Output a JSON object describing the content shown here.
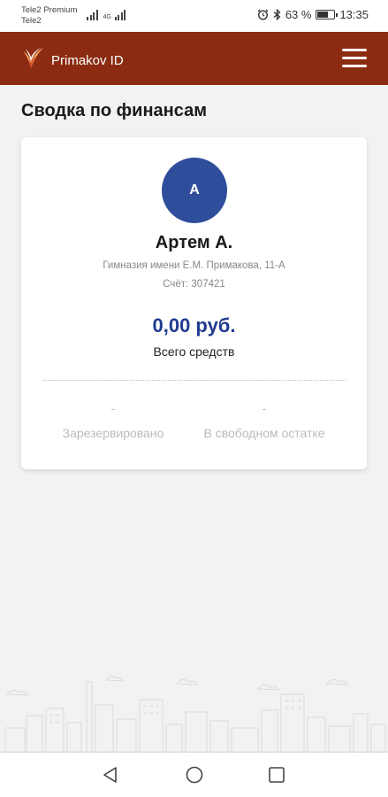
{
  "status_bar": {
    "carrier_1": "Tele2 Premium",
    "carrier_2": "Tele2",
    "network_type": "4G",
    "battery_percent": "63 %",
    "battery_level": 0.63,
    "time": "13:35"
  },
  "app_bar": {
    "title": "Primakov ID",
    "logo_icon": "primakov-logo-icon",
    "menu_icon": "hamburger-menu-icon"
  },
  "page": {
    "title": "Сводка по финансам"
  },
  "profile": {
    "avatar_initial": "А",
    "name": "Артем А.",
    "school": "Гимназия имени Е.М. Примакова, 11-А",
    "account": "Счёт: 307421"
  },
  "finances": {
    "total_amount": "0,00 руб.",
    "total_label": "Всего средств",
    "reserved_value": "-",
    "reserved_label": "Зарезервировано",
    "free_value": "-",
    "free_label": "В свободном остатке"
  },
  "nav_bar": {
    "back_icon": "back-triangle-icon",
    "home_icon": "home-circle-icon",
    "recents_icon": "recents-square-icon"
  },
  "colors": {
    "app_bar": "#8b2c12",
    "avatar": "#2e4d9b",
    "amount": "#1f3a8f"
  }
}
